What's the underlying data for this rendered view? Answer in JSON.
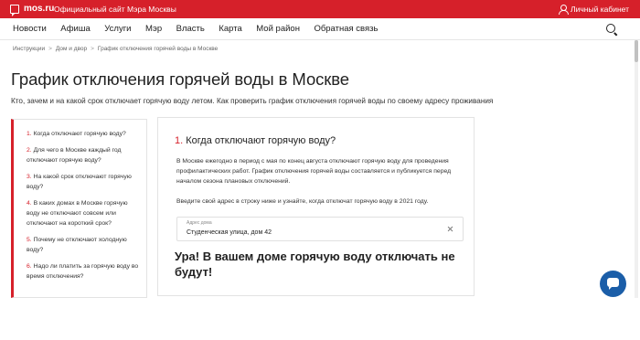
{
  "topbar": {
    "logo": "mos.ru",
    "site_title": "Официальный сайт Мэра Москвы",
    "cabinet_label": "Личный кабинет",
    "color": "#d6202a"
  },
  "nav": {
    "items": [
      "Новости",
      "Афиша",
      "Услуги",
      "Мэр",
      "Власть",
      "Карта",
      "Мой район",
      "Обратная связь"
    ]
  },
  "breadcrumb": [
    "Инструкции",
    "Дом и двор",
    "График отключения горячей воды в Москве"
  ],
  "page": {
    "title": "График отключения горячей воды в Москве",
    "lead": "Кто, зачем и на какой срок отключает горячую воду летом. Как проверить график отключения горячей воды по своему адресу проживания"
  },
  "sidebar": {
    "items": [
      {
        "num": "1.",
        "label": "Когда отключают горячую воду?"
      },
      {
        "num": "2.",
        "label": "Для чего в Москве каждый год отключают горячую воду?"
      },
      {
        "num": "3.",
        "label": "На какой срок отключают горячую воду?"
      },
      {
        "num": "4.",
        "label": "В каких домах в Москве горячую воду не отключают совсем или отключают на короткий срок?"
      },
      {
        "num": "5.",
        "label": "Почему не отключают холодную воду?"
      },
      {
        "num": "6.",
        "label": "Надо ли платить за горячую воду во время отключения?"
      }
    ]
  },
  "content": {
    "section_num": "1.",
    "section_title": "Когда отключают горячую воду?",
    "paragraph": "В Москве ежегодно в период с мая по конец августа отключают горячую воду для проведения профилактических работ. График отключения горячей воды составляется и публикуется перед началом сезона плановых отключений.",
    "paragraph2": "Введите свой адрес в строку ниже и узнайте, когда отключат горячую воду в 2021 году.",
    "address_label": "Адрес дома",
    "address_value": "Студенческая улица, дом 42",
    "result": "Ура! В вашем доме горячую воду отключать не будут!"
  },
  "icons": {
    "logo": "mos-logo-icon",
    "user": "user-icon",
    "search": "search-icon",
    "clear": "close-icon",
    "chat": "chat-icon"
  },
  "colors": {
    "accent": "#d6202a",
    "chat": "#1b5ea8"
  }
}
